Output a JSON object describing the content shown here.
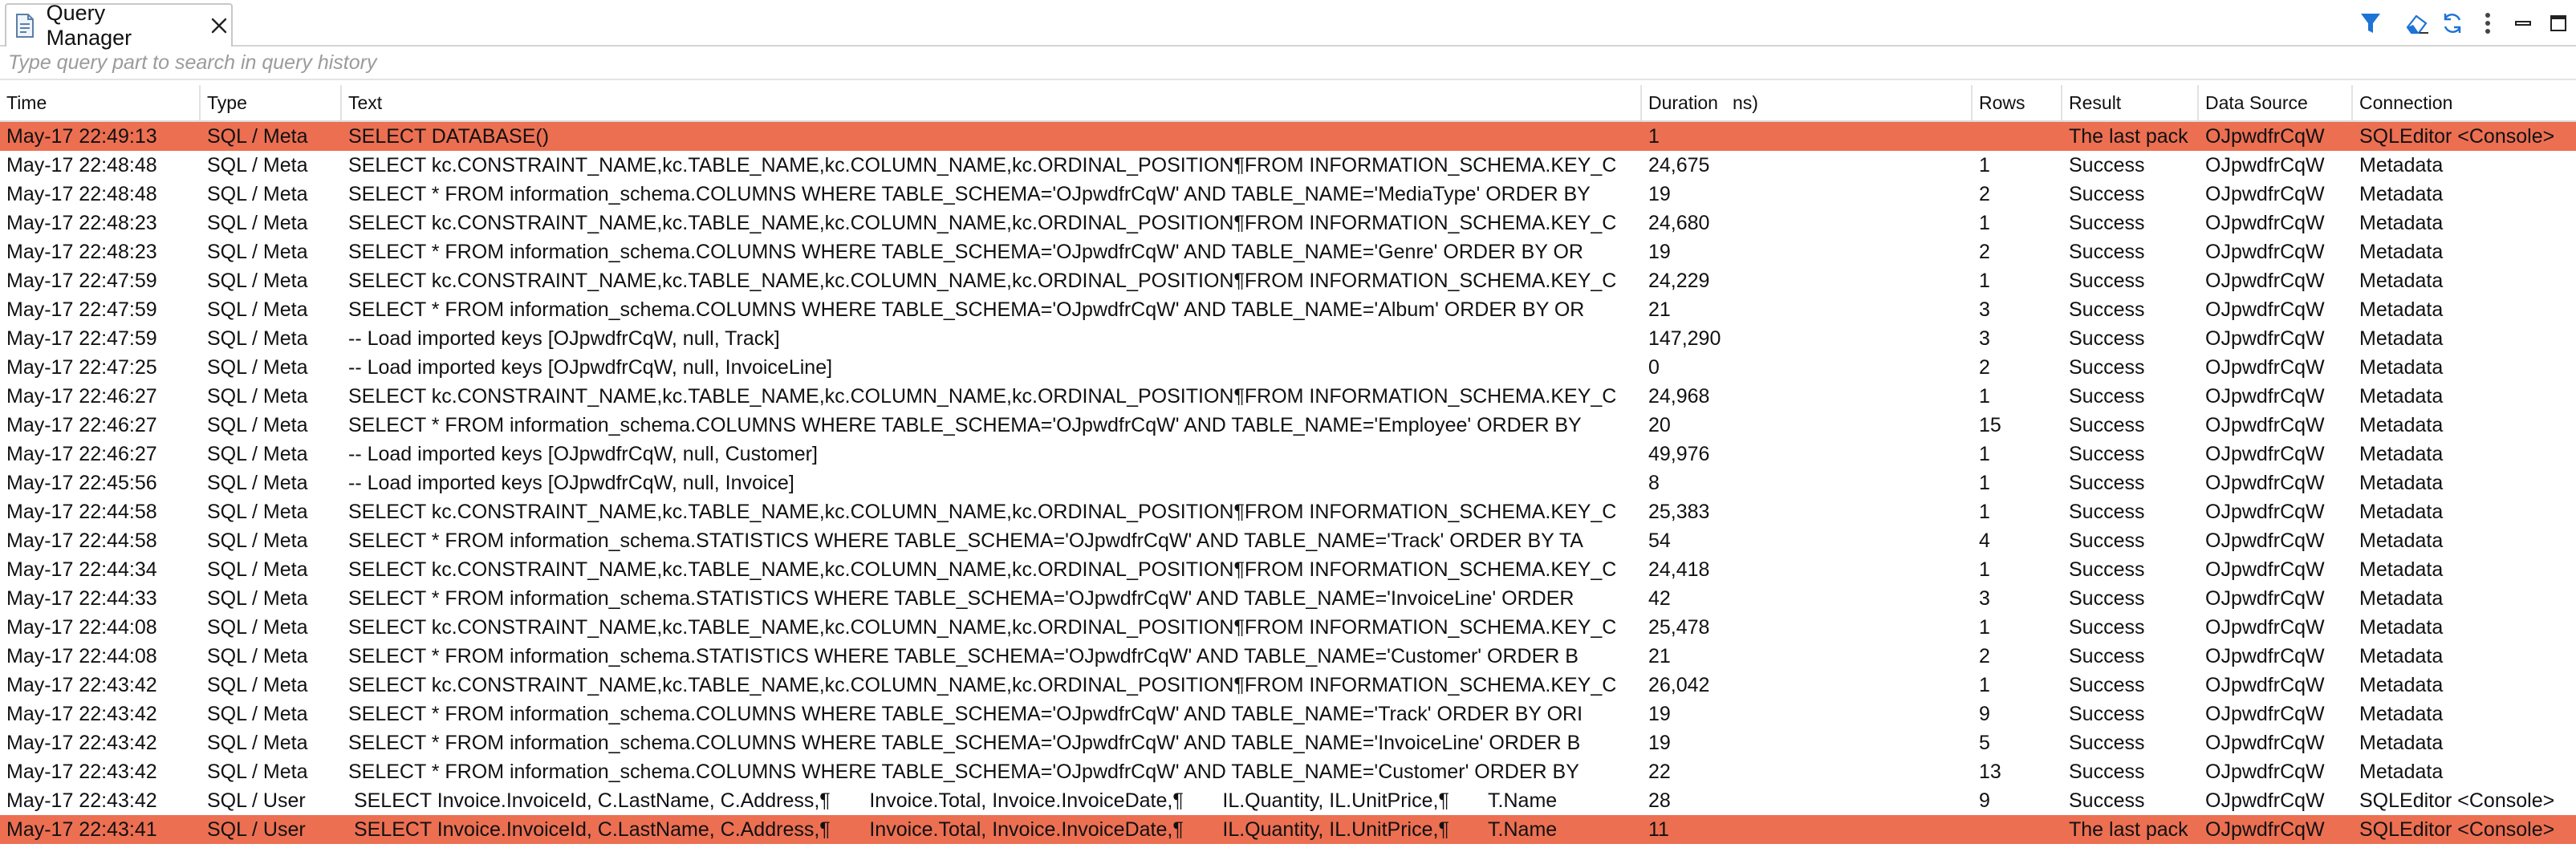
{
  "tab": {
    "title": "Query Manager",
    "icon": "query-manager-icon",
    "close_icon": "close-icon"
  },
  "toolbar": {
    "buttons": [
      {
        "name": "filter-icon"
      },
      {
        "name": "clear-log-icon"
      },
      {
        "name": "refresh-icon"
      },
      {
        "name": "view-menu-icon"
      },
      {
        "name": "minimize-icon"
      },
      {
        "name": "maximize-icon"
      }
    ]
  },
  "search": {
    "placeholder": "Type query part to search in query history",
    "value": ""
  },
  "columns": {
    "time": "Time",
    "type": "Type",
    "text": "Text",
    "duration": "Duration",
    "duration_unit_fragment": "ns)",
    "rows": "Rows",
    "result": "Result",
    "datasource": "Data Source",
    "connection": "Connection"
  },
  "colors": {
    "error_row": "#ec6f52",
    "accent": "#1e73d6"
  },
  "rows": [
    {
      "time": "May-17 22:49:13",
      "type": "SQL / Meta",
      "text": "SELECT DATABASE()",
      "duration": "1",
      "rows": "",
      "result": "The last pack",
      "datasource": "OJpwdfrCqW",
      "connection": "SQLEditor <Console>",
      "error": true
    },
    {
      "time": "May-17 22:48:48",
      "type": "SQL / Meta",
      "text": "SELECT kc.CONSTRAINT_NAME,kc.TABLE_NAME,kc.COLUMN_NAME,kc.ORDINAL_POSITION¶FROM INFORMATION_SCHEMA.KEY_C",
      "duration": "24,675",
      "rows": "1",
      "result": "Success",
      "datasource": "OJpwdfrCqW",
      "connection": "Metadata",
      "error": false
    },
    {
      "time": "May-17 22:48:48",
      "type": "SQL / Meta",
      "text": "SELECT * FROM information_schema.COLUMNS WHERE TABLE_SCHEMA='OJpwdfrCqW' AND TABLE_NAME='MediaType' ORDER BY",
      "duration": "19",
      "rows": "2",
      "result": "Success",
      "datasource": "OJpwdfrCqW",
      "connection": "Metadata",
      "error": false
    },
    {
      "time": "May-17 22:48:23",
      "type": "SQL / Meta",
      "text": "SELECT kc.CONSTRAINT_NAME,kc.TABLE_NAME,kc.COLUMN_NAME,kc.ORDINAL_POSITION¶FROM INFORMATION_SCHEMA.KEY_C",
      "duration": "24,680",
      "rows": "1",
      "result": "Success",
      "datasource": "OJpwdfrCqW",
      "connection": "Metadata",
      "error": false
    },
    {
      "time": "May-17 22:48:23",
      "type": "SQL / Meta",
      "text": "SELECT * FROM information_schema.COLUMNS WHERE TABLE_SCHEMA='OJpwdfrCqW' AND TABLE_NAME='Genre' ORDER BY OR",
      "duration": "19",
      "rows": "2",
      "result": "Success",
      "datasource": "OJpwdfrCqW",
      "connection": "Metadata",
      "error": false
    },
    {
      "time": "May-17 22:47:59",
      "type": "SQL / Meta",
      "text": "SELECT kc.CONSTRAINT_NAME,kc.TABLE_NAME,kc.COLUMN_NAME,kc.ORDINAL_POSITION¶FROM INFORMATION_SCHEMA.KEY_C",
      "duration": "24,229",
      "rows": "1",
      "result": "Success",
      "datasource": "OJpwdfrCqW",
      "connection": "Metadata",
      "error": false
    },
    {
      "time": "May-17 22:47:59",
      "type": "SQL / Meta",
      "text": "SELECT * FROM information_schema.COLUMNS WHERE TABLE_SCHEMA='OJpwdfrCqW' AND TABLE_NAME='Album' ORDER BY OR",
      "duration": "21",
      "rows": "3",
      "result": "Success",
      "datasource": "OJpwdfrCqW",
      "connection": "Metadata",
      "error": false
    },
    {
      "time": "May-17 22:47:59",
      "type": "SQL / Meta",
      "text": "-- Load imported keys [OJpwdfrCqW, null, Track]",
      "duration": "147,290",
      "rows": "3",
      "result": "Success",
      "datasource": "OJpwdfrCqW",
      "connection": "Metadata",
      "error": false
    },
    {
      "time": "May-17 22:47:25",
      "type": "SQL / Meta",
      "text": "-- Load imported keys [OJpwdfrCqW, null, InvoiceLine]",
      "duration": "0",
      "rows": "2",
      "result": "Success",
      "datasource": "OJpwdfrCqW",
      "connection": "Metadata",
      "error": false
    },
    {
      "time": "May-17 22:46:27",
      "type": "SQL / Meta",
      "text": "SELECT kc.CONSTRAINT_NAME,kc.TABLE_NAME,kc.COLUMN_NAME,kc.ORDINAL_POSITION¶FROM INFORMATION_SCHEMA.KEY_C",
      "duration": "24,968",
      "rows": "1",
      "result": "Success",
      "datasource": "OJpwdfrCqW",
      "connection": "Metadata",
      "error": false
    },
    {
      "time": "May-17 22:46:27",
      "type": "SQL / Meta",
      "text": "SELECT * FROM information_schema.COLUMNS WHERE TABLE_SCHEMA='OJpwdfrCqW' AND TABLE_NAME='Employee' ORDER BY",
      "duration": "20",
      "rows": "15",
      "result": "Success",
      "datasource": "OJpwdfrCqW",
      "connection": "Metadata",
      "error": false
    },
    {
      "time": "May-17 22:46:27",
      "type": "SQL / Meta",
      "text": "-- Load imported keys [OJpwdfrCqW, null, Customer]",
      "duration": "49,976",
      "rows": "1",
      "result": "Success",
      "datasource": "OJpwdfrCqW",
      "connection": "Metadata",
      "error": false
    },
    {
      "time": "May-17 22:45:56",
      "type": "SQL / Meta",
      "text": "-- Load imported keys [OJpwdfrCqW, null, Invoice]",
      "duration": "8",
      "rows": "1",
      "result": "Success",
      "datasource": "OJpwdfrCqW",
      "connection": "Metadata",
      "error": false
    },
    {
      "time": "May-17 22:44:58",
      "type": "SQL / Meta",
      "text": "SELECT kc.CONSTRAINT_NAME,kc.TABLE_NAME,kc.COLUMN_NAME,kc.ORDINAL_POSITION¶FROM INFORMATION_SCHEMA.KEY_C",
      "duration": "25,383",
      "rows": "1",
      "result": "Success",
      "datasource": "OJpwdfrCqW",
      "connection": "Metadata",
      "error": false
    },
    {
      "time": "May-17 22:44:58",
      "type": "SQL / Meta",
      "text": "SELECT * FROM information_schema.STATISTICS WHERE TABLE_SCHEMA='OJpwdfrCqW' AND TABLE_NAME='Track' ORDER BY TA",
      "duration": "54",
      "rows": "4",
      "result": "Success",
      "datasource": "OJpwdfrCqW",
      "connection": "Metadata",
      "error": false
    },
    {
      "time": "May-17 22:44:34",
      "type": "SQL / Meta",
      "text": "SELECT kc.CONSTRAINT_NAME,kc.TABLE_NAME,kc.COLUMN_NAME,kc.ORDINAL_POSITION¶FROM INFORMATION_SCHEMA.KEY_C",
      "duration": "24,418",
      "rows": "1",
      "result": "Success",
      "datasource": "OJpwdfrCqW",
      "connection": "Metadata",
      "error": false
    },
    {
      "time": "May-17 22:44:33",
      "type": "SQL / Meta",
      "text": "SELECT * FROM information_schema.STATISTICS WHERE TABLE_SCHEMA='OJpwdfrCqW' AND TABLE_NAME='InvoiceLine' ORDER",
      "duration": "42",
      "rows": "3",
      "result": "Success",
      "datasource": "OJpwdfrCqW",
      "connection": "Metadata",
      "error": false
    },
    {
      "time": "May-17 22:44:08",
      "type": "SQL / Meta",
      "text": "SELECT kc.CONSTRAINT_NAME,kc.TABLE_NAME,kc.COLUMN_NAME,kc.ORDINAL_POSITION¶FROM INFORMATION_SCHEMA.KEY_C",
      "duration": "25,478",
      "rows": "1",
      "result": "Success",
      "datasource": "OJpwdfrCqW",
      "connection": "Metadata",
      "error": false
    },
    {
      "time": "May-17 22:44:08",
      "type": "SQL / Meta",
      "text": "SELECT * FROM information_schema.STATISTICS WHERE TABLE_SCHEMA='OJpwdfrCqW' AND TABLE_NAME='Customer' ORDER B",
      "duration": "21",
      "rows": "2",
      "result": "Success",
      "datasource": "OJpwdfrCqW",
      "connection": "Metadata",
      "error": false
    },
    {
      "time": "May-17 22:43:42",
      "type": "SQL / Meta",
      "text": "SELECT kc.CONSTRAINT_NAME,kc.TABLE_NAME,kc.COLUMN_NAME,kc.ORDINAL_POSITION¶FROM INFORMATION_SCHEMA.KEY_C",
      "duration": "26,042",
      "rows": "1",
      "result": "Success",
      "datasource": "OJpwdfrCqW",
      "connection": "Metadata",
      "error": false
    },
    {
      "time": "May-17 22:43:42",
      "type": "SQL / Meta",
      "text": "SELECT * FROM information_schema.COLUMNS WHERE TABLE_SCHEMA='OJpwdfrCqW' AND TABLE_NAME='Track' ORDER BY ORI",
      "duration": "19",
      "rows": "9",
      "result": "Success",
      "datasource": "OJpwdfrCqW",
      "connection": "Metadata",
      "error": false
    },
    {
      "time": "May-17 22:43:42",
      "type": "SQL / Meta",
      "text": "SELECT * FROM information_schema.COLUMNS WHERE TABLE_SCHEMA='OJpwdfrCqW' AND TABLE_NAME='InvoiceLine' ORDER B",
      "duration": "19",
      "rows": "5",
      "result": "Success",
      "datasource": "OJpwdfrCqW",
      "connection": "Metadata",
      "error": false
    },
    {
      "time": "May-17 22:43:42",
      "type": "SQL / Meta",
      "text": "SELECT * FROM information_schema.COLUMNS WHERE TABLE_SCHEMA='OJpwdfrCqW' AND TABLE_NAME='Customer' ORDER BY",
      "duration": "22",
      "rows": "13",
      "result": "Success",
      "datasource": "OJpwdfrCqW",
      "connection": "Metadata",
      "error": false
    },
    {
      "time": "May-17 22:43:42",
      "type": "SQL / User",
      "text": " SELECT Invoice.InvoiceId, C.LastName, C.Address,¶       Invoice.Total, Invoice.InvoiceDate,¶       IL.Quantity, IL.UnitPrice,¶       T.Name",
      "duration": "28",
      "rows": "9",
      "result": "Success",
      "datasource": "OJpwdfrCqW",
      "connection": "SQLEditor <Console>",
      "error": false
    },
    {
      "time": "May-17 22:43:41",
      "type": "SQL / User",
      "text": " SELECT Invoice.InvoiceId, C.LastName, C.Address,¶       Invoice.Total, Invoice.InvoiceDate,¶       IL.Quantity, IL.UnitPrice,¶       T.Name",
      "duration": "11",
      "rows": "",
      "result": "The last pack",
      "datasource": "OJpwdfrCqW",
      "connection": "SQLEditor <Console>",
      "error": true
    }
  ]
}
